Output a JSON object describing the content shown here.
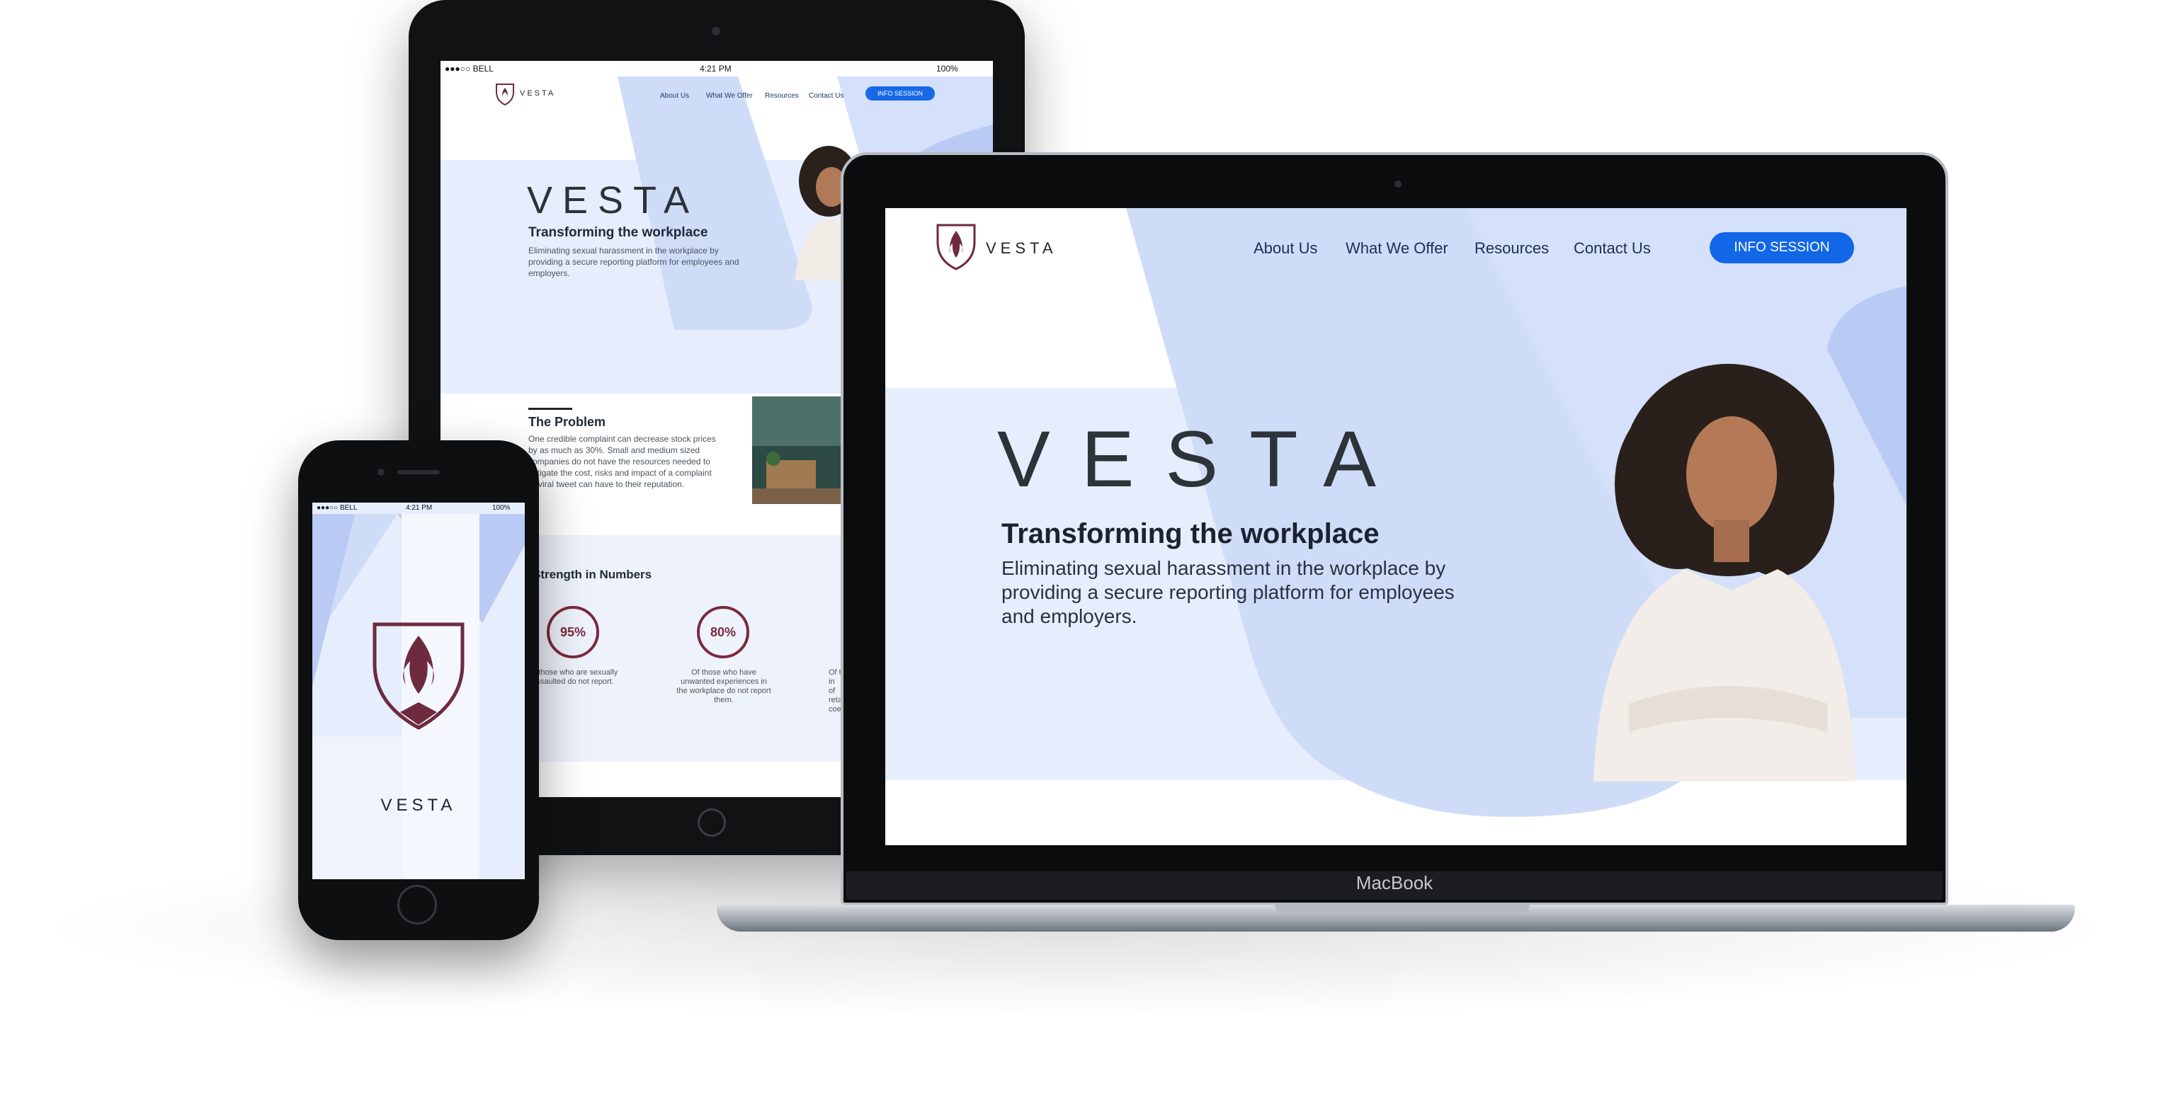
{
  "tablet": {
    "status": {
      "carrier": "●●●○○ BELL",
      "time": "4:21 PM",
      "battery": "100%"
    },
    "brand": {
      "logo_text": "VESTA"
    },
    "nav": [
      "About Us",
      "What We Offer",
      "Resources",
      "Contact Us"
    ],
    "cta": "INFO SESSION",
    "hero": {
      "wordmark": "VESTA",
      "heading": "Transforming the workplace",
      "body": "Eliminating sexual harassment in the workplace by providing a secure reporting platform for employees and employers."
    },
    "problem": {
      "heading": "The Problem",
      "body": "One credible complaint can decrease stock prices by as much as 30%. Small and medium sized companies do not have the resources needed to mitigate the cost, risks and impact of a complaint or viral tweet can have to their reputation."
    },
    "numbers": {
      "heading": "Strength in Numbers",
      "stats": [
        {
          "value": "95%",
          "caption": "Of those who are sexually assaulted do not report."
        },
        {
          "value": "80%",
          "caption": "Of those who have unwanted experiences in the workplace do not report them."
        },
        {
          "value": "",
          "caption": "Of th\nin\nof\nretal\ncoe"
        }
      ]
    }
  },
  "phone": {
    "status": {
      "carrier": "●●●○○ BELL",
      "time": "4:21 PM",
      "battery": "100%"
    },
    "wordmark": "VESTA"
  },
  "laptop": {
    "brand_label": "MacBook",
    "logo_text": "VESTA",
    "nav": [
      "About Us",
      "What We Offer",
      "Resources",
      "Contact Us"
    ],
    "cta": "INFO SESSION",
    "hero": {
      "wordmark": "VESTA",
      "heading": "Transforming the workplace",
      "body": "Eliminating sexual harassment in the workplace by providing a secure reporting platform for employees and employers."
    }
  },
  "colors": {
    "accent_blue": "#1266e8",
    "shape_light": "#e6edfc",
    "shape_mid": "#cfdcf8",
    "shape_strong": "#b9cbf5",
    "logo_maroon": "#6e2b3f",
    "text_dark": "#1f2330"
  }
}
